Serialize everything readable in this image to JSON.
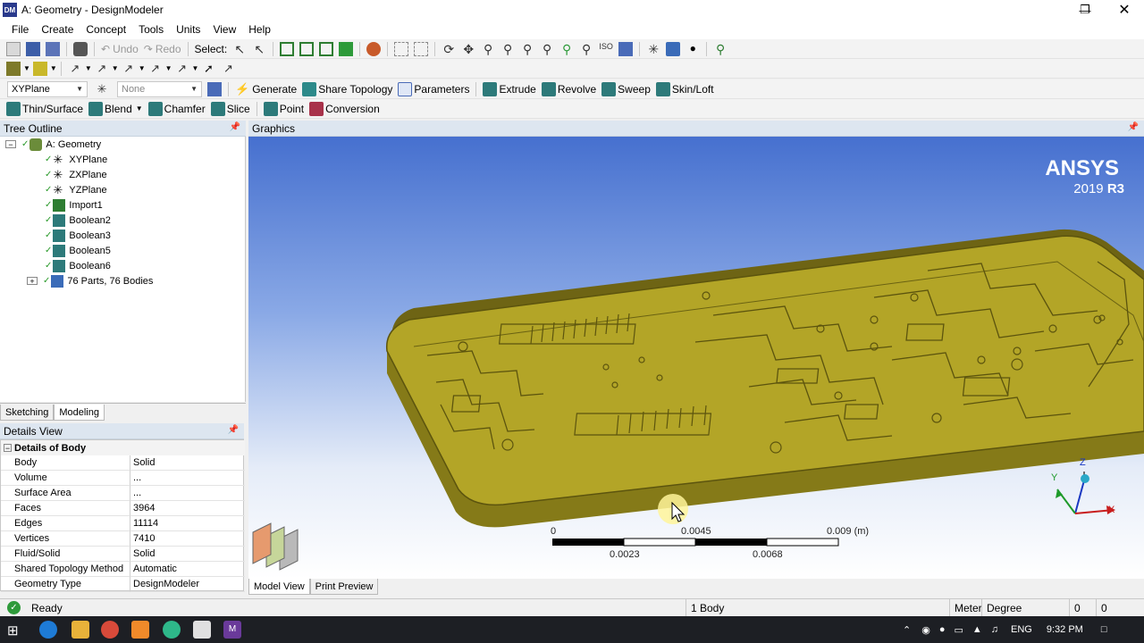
{
  "window": {
    "title": "A: Geometry - DesignModeler",
    "app_icon": "DM"
  },
  "menu": [
    "File",
    "Create",
    "Concept",
    "Tools",
    "Units",
    "View",
    "Help"
  ],
  "toolbar1": {
    "undo": "Undo",
    "redo": "Redo",
    "select": "Select:"
  },
  "toolbar3": {
    "plane": "XYPlane",
    "sketch": "None",
    "generate": "Generate",
    "share_topology": "Share Topology",
    "parameters": "Parameters",
    "extrude": "Extrude",
    "revolve": "Revolve",
    "sweep": "Sweep",
    "skin_loft": "Skin/Loft"
  },
  "toolbar4": {
    "thin_surface": "Thin/Surface",
    "blend": "Blend",
    "chamfer": "Chamfer",
    "slice": "Slice",
    "point": "Point",
    "conversion": "Conversion"
  },
  "tree": {
    "header": "Tree Outline",
    "root": "A: Geometry",
    "items": [
      "XYPlane",
      "ZXPlane",
      "YZPlane",
      "Import1",
      "Boolean2",
      "Boolean3",
      "Boolean5",
      "Boolean6",
      "76 Parts, 76 Bodies"
    ]
  },
  "tabs": {
    "sketching": "Sketching",
    "modeling": "Modeling"
  },
  "details": {
    "header": "Details View",
    "group": "Details of Body",
    "rows": [
      {
        "key": "Body",
        "value": "Solid"
      },
      {
        "key": "Volume",
        "value": "..."
      },
      {
        "key": "Surface Area",
        "value": "..."
      },
      {
        "key": "Faces",
        "value": "3964"
      },
      {
        "key": "Edges",
        "value": "11114"
      },
      {
        "key": "Vertices",
        "value": "7410"
      },
      {
        "key": "Fluid/Solid",
        "value": "Solid"
      },
      {
        "key": "Shared Topology Method",
        "value": "Automatic"
      },
      {
        "key": "Geometry Type",
        "value": "DesignModeler"
      }
    ]
  },
  "graphics": {
    "header": "Graphics",
    "brand": "ANSYS",
    "version_year": "2019",
    "version_release": "R3",
    "scale": {
      "t0": "0",
      "t1": "0.0045",
      "t2": "0.009 (m)",
      "b1": "0.0023",
      "b2": "0.0068"
    },
    "triad": {
      "x": "X",
      "y": "Y",
      "z": "Z"
    }
  },
  "view_tabs": {
    "model_view": "Model View",
    "print_preview": "Print Preview"
  },
  "status": {
    "ready": "Ready",
    "selection": "1 Body",
    "unit_length": "Meter",
    "unit_angle": "Degree",
    "v1": "0",
    "v2": "0"
  },
  "taskbar": {
    "lang": "ENG",
    "time": "9:32 PM"
  },
  "colors": {
    "model_fill": "#b3a527",
    "graphics_top": "#4670cf",
    "accent": "#2a3a8c"
  }
}
